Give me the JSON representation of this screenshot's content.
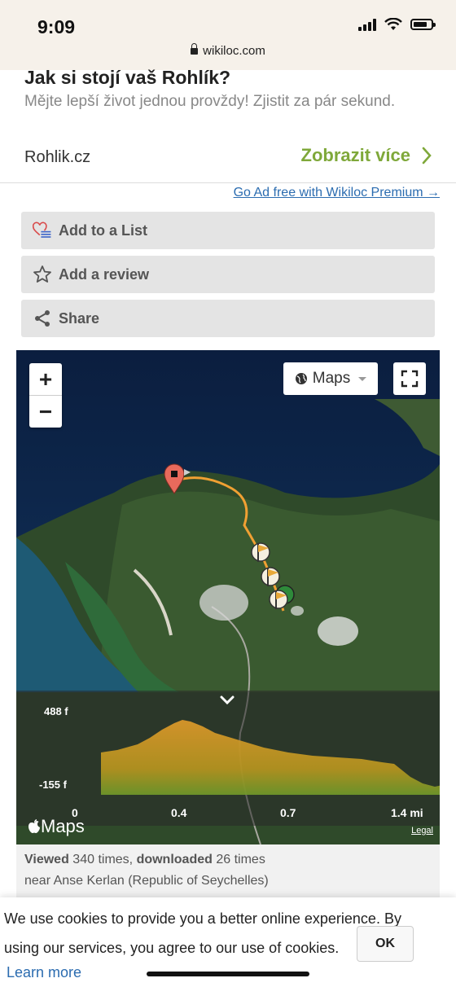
{
  "status_bar": {
    "time": "9:09",
    "url": "wikiloc.com"
  },
  "ad": {
    "title": "Jak si stojí vaš Rohlík?",
    "description": "Mějte lepší život jednou provždy! Zjistit za pár sekund.",
    "domain": "Rohlik.cz",
    "cta_label": "Zobrazit více",
    "cta_color": "#7fa83a"
  },
  "premium_link": "Go Ad free with Wikiloc Premium →",
  "actions": {
    "add_to_list": "Add to a List",
    "add_review": "Add a review",
    "share": "Share"
  },
  "map": {
    "zoom_in": "+",
    "zoom_out": "−",
    "layer_button": "Maps",
    "elevation": {
      "max_label": "488 f",
      "min_label": "-155 f",
      "x_ticks": [
        "0",
        "0.4",
        "0.7",
        "1.4 mi"
      ]
    },
    "provider": "Maps",
    "legal": "Legal"
  },
  "stats": {
    "viewed_label": "Viewed",
    "viewed_text": "340 times,",
    "downloaded_label": "downloaded",
    "downloaded_text": "26 times",
    "location": "near Anse Kerlan (Republic of Seychelles)"
  },
  "cookie": {
    "text": "We use cookies to provide you a better online experience. By using our services, you agree to our use of cookies.",
    "ok": "OK",
    "learn_more": "Learn more"
  }
}
